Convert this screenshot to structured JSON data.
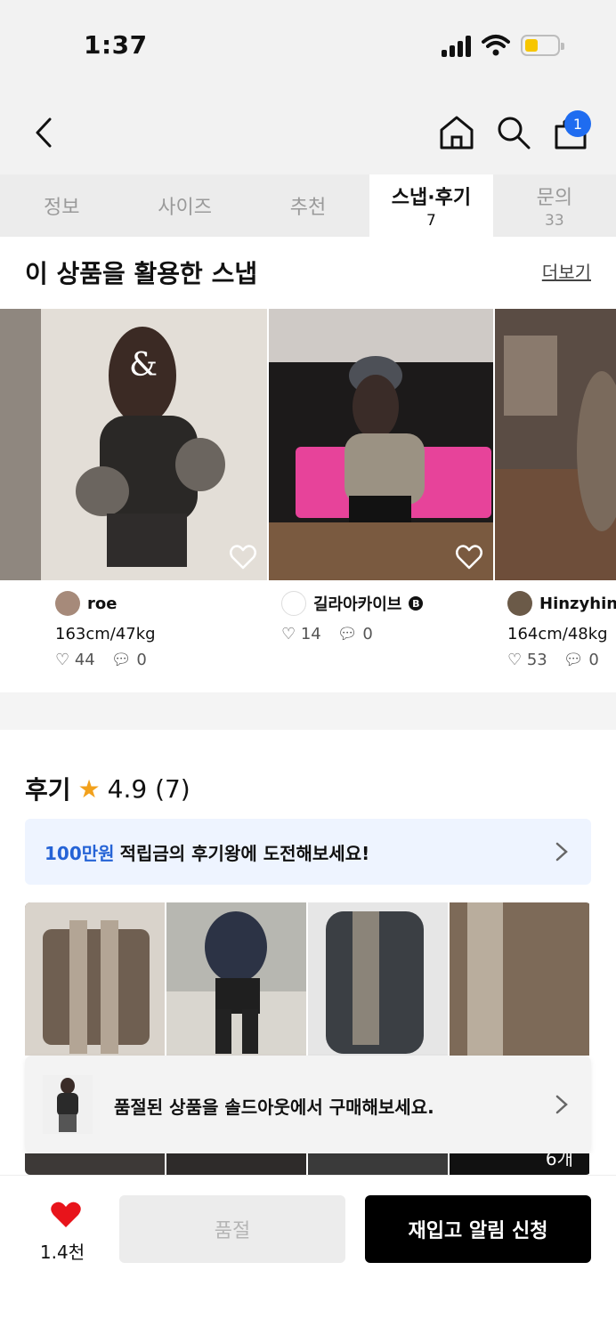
{
  "status_bar": {
    "time": "1:37"
  },
  "header": {
    "cart_count": "1"
  },
  "tabs": [
    {
      "label": "정보",
      "count": ""
    },
    {
      "label": "사이즈",
      "count": ""
    },
    {
      "label": "추천",
      "count": ""
    },
    {
      "label": "스냅·후기",
      "count": "7",
      "active": true
    },
    {
      "label": "문의",
      "count": "33"
    }
  ],
  "snap_section": {
    "title": "이 상품을 활용한 스냅",
    "more_label": "더보기",
    "items": [
      {
        "user": "roe",
        "body": "163cm/47kg",
        "likes": "44",
        "comments": "0"
      },
      {
        "user": "길라아카이브",
        "body": "",
        "likes": "14",
        "comments": "0"
      },
      {
        "user": "Hinzyhin",
        "body": "164cm/48kg",
        "likes": "53",
        "comments": "0"
      }
    ]
  },
  "reviews": {
    "title": "후기",
    "rating": "4.9 (7)",
    "promo_highlight": "100만원",
    "promo_text": "적립금의 후기왕에 도전해보세요!",
    "more_count": "6개"
  },
  "soldout_banner": {
    "text": "품절된 상품을 솔드아웃에서 구매해보세요."
  },
  "bottom_bar": {
    "like_count": "1.4천",
    "soldout_label": "품절",
    "notify_label": "재입고 알림 신청"
  },
  "colors": {
    "accent_blue": "#1f6cf0",
    "promo_blue": "#2563d6",
    "heart_red": "#e8141b",
    "star": "#f2a11c"
  }
}
